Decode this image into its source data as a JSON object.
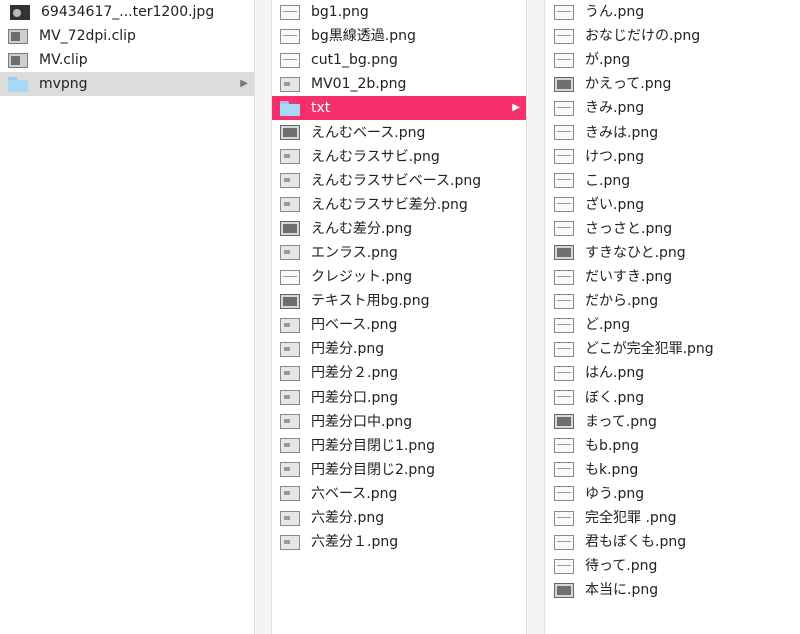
{
  "column1": {
    "items": [
      {
        "name": "69434617_...ter1200.jpg",
        "icon": "jpg-image-icon"
      },
      {
        "name": "MV_72dpi.clip",
        "icon": "clip-file-icon"
      },
      {
        "name": "MV.clip",
        "icon": "clip-file-icon"
      },
      {
        "name": "mvpng",
        "icon": "folder-icon"
      }
    ]
  },
  "column2": {
    "items": [
      {
        "name": "bg1.png"
      },
      {
        "name": "bg黒線透過.png"
      },
      {
        "name": "cut1_bg.png"
      },
      {
        "name": "MV01_2b.png"
      },
      {
        "name": "txt"
      },
      {
        "name": "えんむベース.png"
      },
      {
        "name": "えんむラスサビ.png"
      },
      {
        "name": "えんむラスサビベース.png"
      },
      {
        "name": "えんむラスサビ差分.png"
      },
      {
        "name": "えんむ差分.png"
      },
      {
        "name": "エンラス.png"
      },
      {
        "name": "クレジット.png"
      },
      {
        "name": "テキスト用bg.png"
      },
      {
        "name": "円ベース.png"
      },
      {
        "name": "円差分.png"
      },
      {
        "name": "円差分２.png"
      },
      {
        "name": "円差分口.png"
      },
      {
        "name": "円差分口中.png"
      },
      {
        "name": "円差分目閉じ1.png"
      },
      {
        "name": "円差分目閉じ2.png"
      },
      {
        "name": "六ベース.png"
      },
      {
        "name": "六差分.png"
      },
      {
        "name": "六差分１.png"
      }
    ]
  },
  "column3": {
    "items": [
      {
        "name": "うん.png"
      },
      {
        "name": "おなじだけの.png"
      },
      {
        "name": "が.png"
      },
      {
        "name": "かえって.png"
      },
      {
        "name": "きみ.png"
      },
      {
        "name": "きみは.png"
      },
      {
        "name": "けつ.png"
      },
      {
        "name": "こ.png"
      },
      {
        "name": "ざい.png"
      },
      {
        "name": "さっさと.png"
      },
      {
        "name": "すきなひと.png"
      },
      {
        "name": "だいすき.png"
      },
      {
        "name": "だから.png"
      },
      {
        "name": "ど.png"
      },
      {
        "name": "どこが完全犯罪.png"
      },
      {
        "name": "はん.png"
      },
      {
        "name": "ぼく.png"
      },
      {
        "name": "まって.png"
      },
      {
        "name": "もb.png"
      },
      {
        "name": "もk.png"
      },
      {
        "name": "ゆう.png"
      },
      {
        "name": "完全犯罪 .png"
      },
      {
        "name": "君もぼくも.png"
      },
      {
        "name": "待って.png"
      },
      {
        "name": "本当に.png"
      }
    ]
  },
  "colors": {
    "selected_active": "#f5306d",
    "selected_inactive": "#dcdcdc",
    "folder": "#a7d8f5"
  }
}
